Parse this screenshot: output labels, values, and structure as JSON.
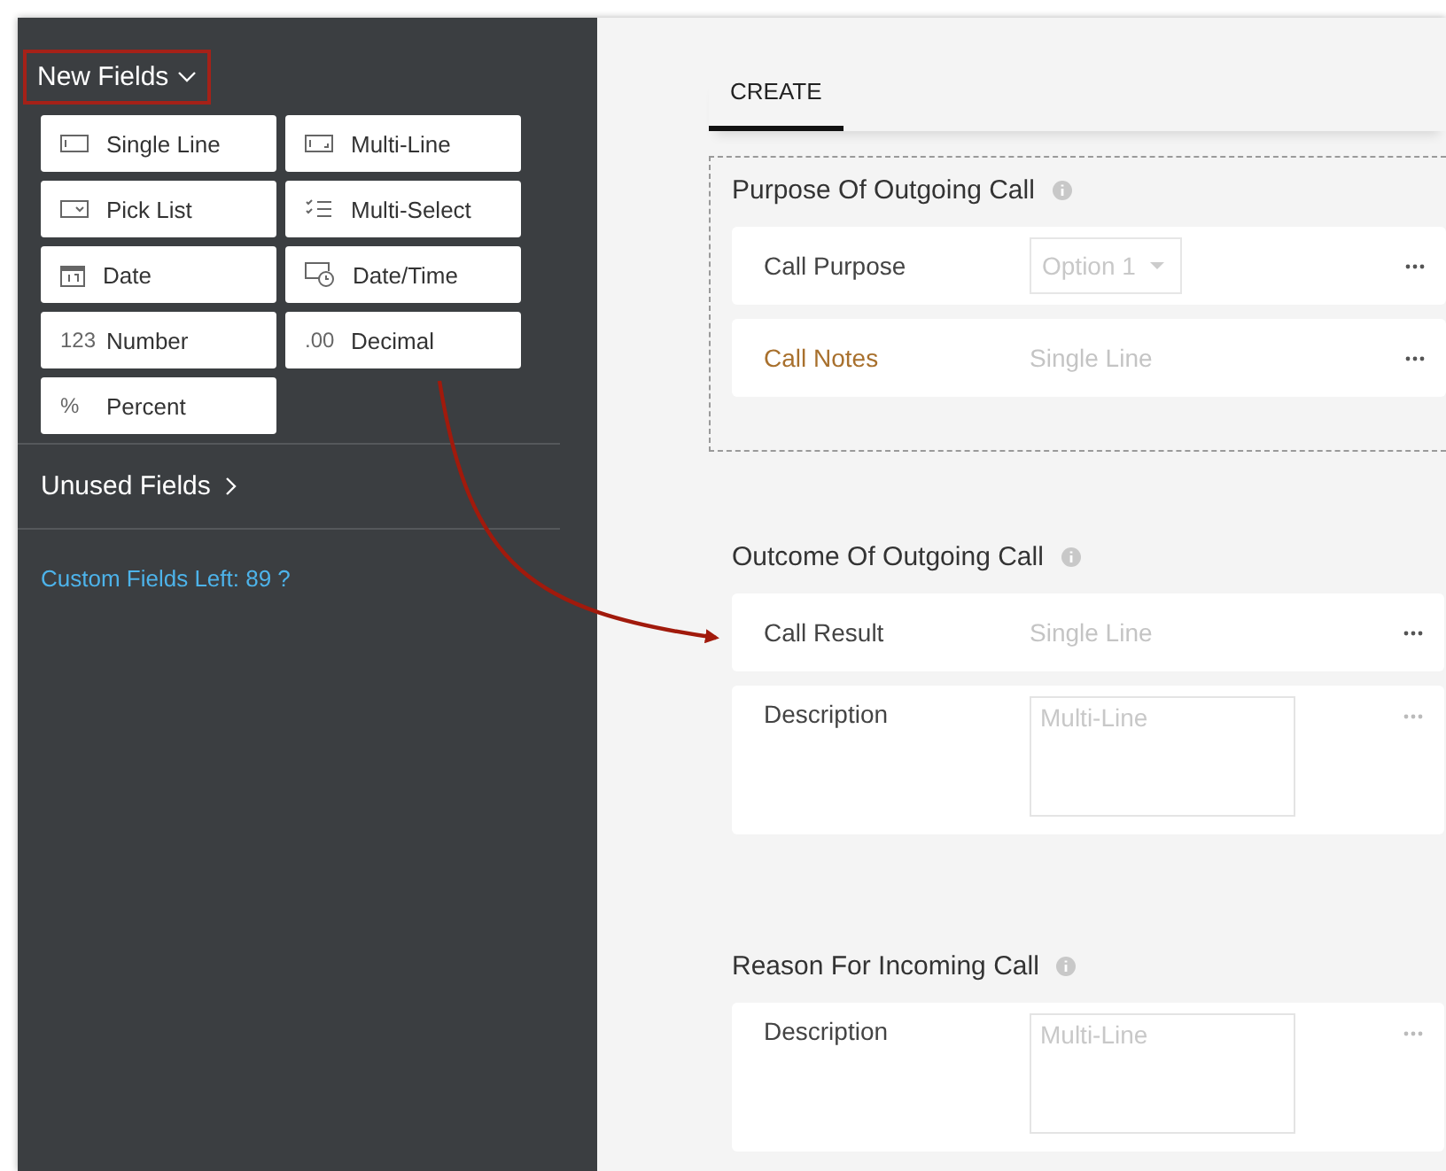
{
  "sidebar": {
    "title": "New Fields",
    "field_types": [
      {
        "kind": "single",
        "label": "Single Line"
      },
      {
        "kind": "multiline",
        "label": "Multi-Line"
      },
      {
        "kind": "picklist",
        "label": "Pick List"
      },
      {
        "kind": "multiselect",
        "label": "Multi-Select"
      },
      {
        "kind": "date",
        "label": "Date"
      },
      {
        "kind": "datetime",
        "label": "Date/Time"
      },
      {
        "kind": "number",
        "label": "Number",
        "glyph": "123"
      },
      {
        "kind": "decimal",
        "label": "Decimal",
        "glyph": ".00"
      },
      {
        "kind": "percent",
        "label": "Percent",
        "glyph": "%"
      }
    ],
    "unused_fields": "Unused Fields",
    "custom_fields_left": "Custom Fields Left: 89 ?"
  },
  "tabs": [
    {
      "label": "CREATE",
      "selected": true
    }
  ],
  "sections": [
    {
      "title": "Purpose Of Outgoing Call",
      "dashed": true,
      "rows": [
        {
          "label": "Call Purpose",
          "highlighted": false,
          "kind": "dropdown",
          "value": "Option 1"
        },
        {
          "label": "Call Notes",
          "highlighted": true,
          "kind": "single",
          "value": "Single Line"
        }
      ]
    },
    {
      "title": "Outcome Of Outgoing Call",
      "dashed": false,
      "rows": [
        {
          "label": "Call Result",
          "highlighted": false,
          "kind": "single",
          "value": "Single Line"
        },
        {
          "label": "Description",
          "highlighted": false,
          "kind": "multiline",
          "value": "Multi-Line"
        }
      ]
    },
    {
      "title": "Reason For Incoming Call",
      "dashed": false,
      "rows": [
        {
          "label": "Description",
          "highlighted": false,
          "kind": "multiline",
          "value": "Multi-Line"
        }
      ]
    }
  ]
}
